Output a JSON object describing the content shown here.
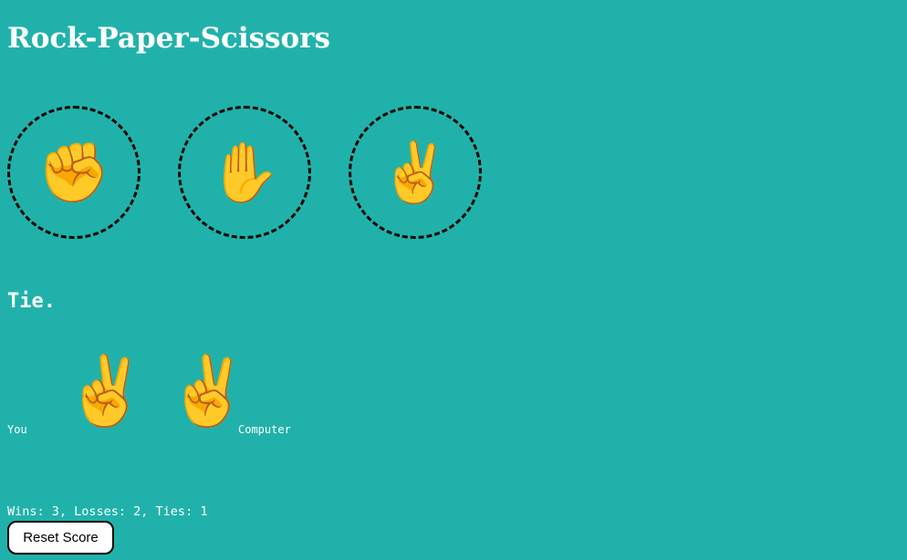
{
  "app": {
    "title": "Rock-Paper-Scissors"
  },
  "moves": [
    {
      "name": "rock",
      "icon": "raised-fist-icon",
      "glyph": "✊"
    },
    {
      "name": "paper",
      "icon": "raised-hand-icon",
      "glyph": "✋"
    },
    {
      "name": "scissors",
      "icon": "victory-hand-icon",
      "glyph": "✌️"
    }
  ],
  "result": {
    "text": "Tie."
  },
  "picks": {
    "you_label": "You",
    "computer_label": "Computer",
    "player_glyph": "✌️",
    "computer_glyph": "✌️"
  },
  "score": {
    "text": "Wins: 3, Losses: 2, Ties: 1",
    "wins": 3,
    "losses": 2,
    "ties": 1
  },
  "controls": {
    "reset_label": "Reset Score"
  },
  "colors": {
    "background": "#20b2aa",
    "text": "#ffffff",
    "circle_border": "#000000",
    "button_bg": "#ffffff",
    "emoji": "#f6c23e"
  }
}
